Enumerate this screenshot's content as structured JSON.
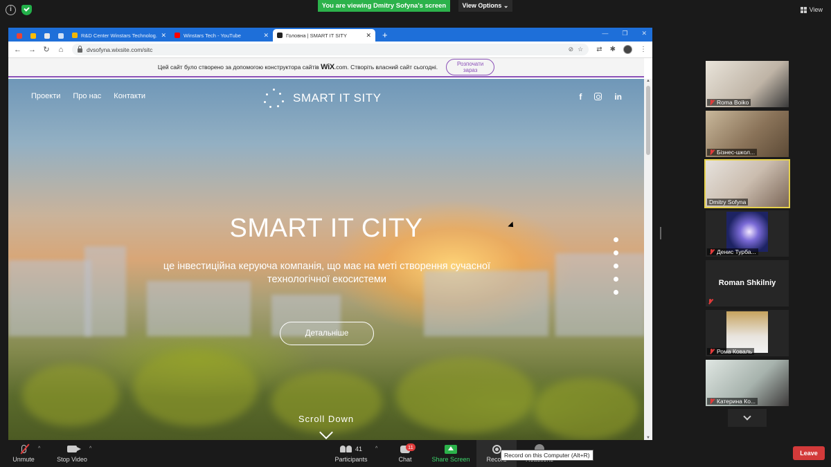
{
  "zoom": {
    "viewing_banner": "You are viewing Dmitry Sofyna's screen",
    "view_options": "View Options",
    "view_label": "View",
    "tooltip": "Record on this Computer (Alt+R)",
    "leave": "Leave",
    "toolbar": {
      "unmute": "Unmute",
      "stop_video": "Stop Video",
      "participants": "Participants",
      "participants_count": "41",
      "chat": "Chat",
      "chat_badge": "11",
      "share_screen": "Share Screen",
      "record": "Record",
      "reactions": "Reactions"
    },
    "participants": [
      {
        "name": "Roma Boiko",
        "muted": true
      },
      {
        "name": "Бізнес-школ...",
        "muted": true
      },
      {
        "name": "Dmitry Sofyna",
        "muted": false,
        "active": true
      },
      {
        "name": "Денис Турба...",
        "muted": true
      },
      {
        "name": "Roman Shkilniy",
        "muted": true,
        "video": false
      },
      {
        "name": "Рома Коваль",
        "muted": true
      },
      {
        "name": "Катерина Ко...",
        "muted": true
      }
    ]
  },
  "browser": {
    "tabs": [
      {
        "title": "R&D Center Winstars Technolog...",
        "icon_color": "#f2b705"
      },
      {
        "title": "Winstars Tech - YouTube",
        "icon_color": "#ff0000"
      },
      {
        "title": "Головна | SMART IT SITY",
        "icon_color": "#222222",
        "active": true
      }
    ],
    "url": "dvsofyna.wixsite.com/sitc"
  },
  "wix_banner": {
    "text_before": "Цей сайт було створено за допомогою конструктора сайтів",
    "brand": "WiX",
    "text_after": ".com. Створіть власний сайт сьогодні.",
    "cta": "Розпочати зараз"
  },
  "site": {
    "nav": [
      "Проекти",
      "Про нас",
      "Контакти"
    ],
    "logo_text": "SMART IT SITY",
    "hero_title": "SMART IT CITY",
    "hero_subtitle": "це інвестиційна керуюча компанія, що має на меті створення сучасної технологічної екосистеми",
    "hero_button": "Детальніше",
    "scroll_down": "Scroll Down",
    "social_fb": "f",
    "social_in": "in"
  }
}
